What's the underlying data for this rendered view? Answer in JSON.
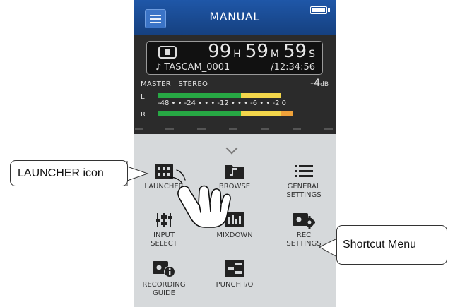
{
  "header": {
    "title": "MANUAL",
    "menu_icon": "hamburger-menu-icon",
    "battery_icon": "battery-icon"
  },
  "transport": {
    "stop_icon": "stop-icon",
    "time": {
      "hours": "99",
      "h_unit": "H",
      "minutes": "59",
      "m_unit": "M",
      "seconds": "59",
      "s_unit": "S"
    },
    "file_name": "♪ TASCAM_0001",
    "total_time": "/12:34:56"
  },
  "meter": {
    "master_label": "MASTER",
    "mode_label": "STEREO",
    "level": "-4",
    "level_unit": "dB",
    "left_label": "L",
    "right_label": "R",
    "scale_text": "-48  •  •  -24  •  •  •  -12  •  •  •  -6  •  •  -2 0",
    "colors": {
      "green": "#27a844",
      "yellow": "#f3d64b",
      "orange": "#f0a23a"
    }
  },
  "launcher": {
    "expand_icon": "chevron-down-icon",
    "items": [
      {
        "label": "LAUNCHER",
        "icon": "launcher-grid-icon"
      },
      {
        "label": "BROWSE",
        "icon": "music-note-folder-icon"
      },
      {
        "label": "GENERAL\nSETTINGS",
        "icon": "list-icon"
      },
      {
        "label": "INPUT\nSELECT",
        "icon": "input-select-icon"
      },
      {
        "label": "MIXDOWN",
        "icon": "mixdown-icon"
      },
      {
        "label": "REC\nSETTINGS",
        "icon": "rec-settings-gear-icon"
      },
      {
        "label": "RECORDING\nGUIDE",
        "icon": "recording-guide-info-icon"
      },
      {
        "label": "PUNCH I/O",
        "icon": "punch-io-icon"
      }
    ]
  },
  "callouts": {
    "launcher_icon": "LAUNCHER icon",
    "shortcut_menu": "Shortcut Menu"
  },
  "hand_icon": "pointing-hand-icon"
}
